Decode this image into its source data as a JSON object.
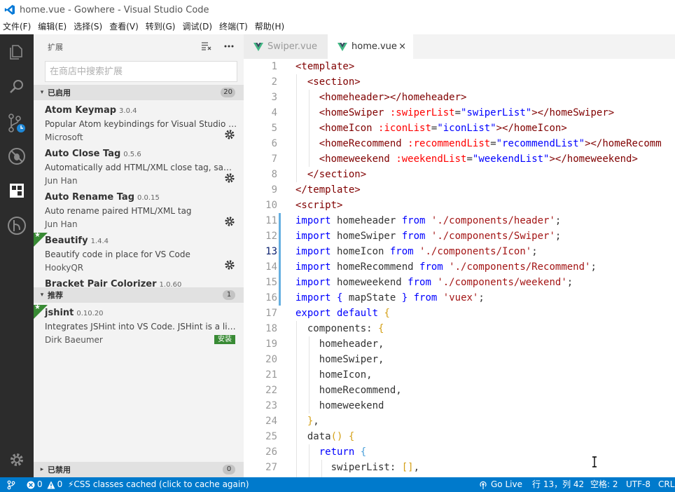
{
  "window": {
    "title": "home.vue - Gowhere - Visual Studio Code"
  },
  "menubar": {
    "items": [
      "文件(F)",
      "编辑(E)",
      "选择(S)",
      "查看(V)",
      "转到(G)",
      "调试(D)",
      "终端(T)",
      "帮助(H)"
    ]
  },
  "activitybar": {
    "icons": [
      "files-icon",
      "search-icon",
      "source-control-icon",
      "debug-icon",
      "extensions-icon",
      "git-lens-icon",
      "settings-gear-icon"
    ]
  },
  "sidebar": {
    "title": "扩展",
    "search_placeholder": "在商店中搜索扩展",
    "enabled_section": {
      "label": "已启用",
      "count": "20"
    },
    "recommended_section": {
      "label": "推荐",
      "count": "1"
    },
    "disabled_section": {
      "label": "已禁用",
      "count": "0"
    },
    "extensions": [
      {
        "name": "Atom Keymap",
        "version": "3.0.4",
        "description": "Popular Atom keybindings for Visual Studio C...",
        "publisher": "Microsoft"
      },
      {
        "name": "Auto Close Tag",
        "version": "0.5.6",
        "description": "Automatically add HTML/XML close tag, same...",
        "publisher": "Jun Han"
      },
      {
        "name": "Auto Rename Tag",
        "version": "0.0.15",
        "description": "Auto rename paired HTML/XML tag",
        "publisher": "Jun Han"
      },
      {
        "name": "Beautify",
        "version": "1.4.4",
        "description": "Beautify code in place for VS Code",
        "publisher": "HookyQR"
      },
      {
        "name": "Bracket Pair Colorizer",
        "version": "1.0.60"
      }
    ],
    "recommended": [
      {
        "name": "jshint",
        "version": "0.10.20",
        "description": "Integrates JSHint into VS Code. JSHint is a lint...",
        "publisher": "Dirk Baeumer",
        "install_label": "安装"
      }
    ]
  },
  "tabs": [
    {
      "label": "Swiper.vue",
      "active": false
    },
    {
      "label": "home.vue",
      "active": true,
      "close": "×"
    }
  ],
  "editor": {
    "current_line": 13,
    "line_numbers": [
      "1",
      "2",
      "3",
      "4",
      "5",
      "6",
      "7",
      "8",
      "9",
      "10",
      "11",
      "12",
      "13",
      "14",
      "15",
      "16",
      "17",
      "18",
      "19",
      "20",
      "21",
      "22",
      "23",
      "24",
      "25",
      "26",
      "27"
    ]
  },
  "statusbar": {
    "errors": "0",
    "warnings": "0",
    "css_message": "⚡CSS classes cached (click to cache again)",
    "go_live": "Go Live",
    "position": "行 13，列 42",
    "spaces": "空格: 2",
    "encoding": "UTF-8",
    "eol": "CRLF"
  },
  "colors": {
    "activitybar": "#2c2c2c",
    "statusbar": "#007acc",
    "install_badge": "#388a34",
    "vue_green": "#41b883"
  }
}
